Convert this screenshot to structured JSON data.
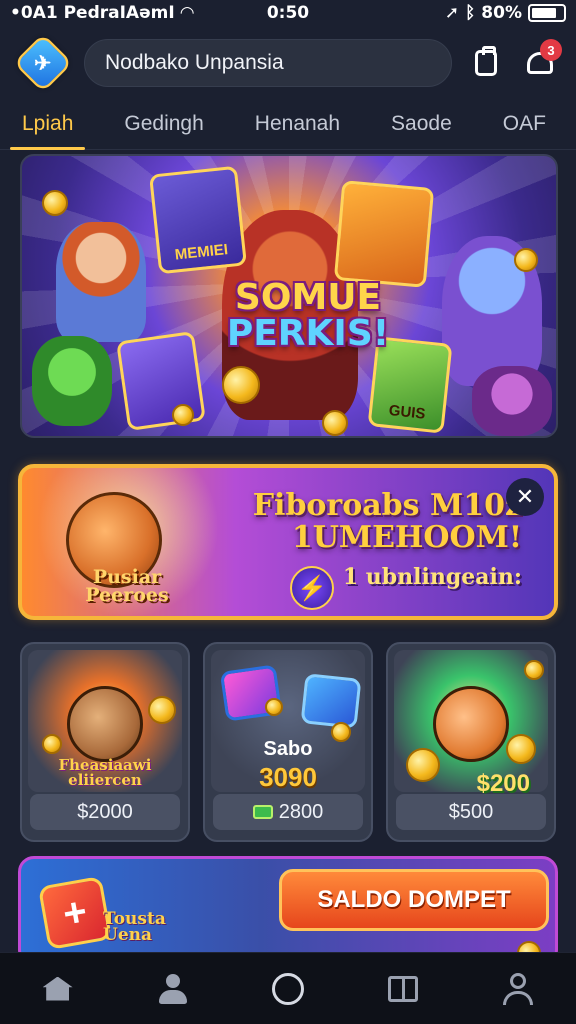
{
  "status_bar": {
    "carrier": "•0A1 PedraІAəmI",
    "time": "0:50",
    "battery": "80%",
    "icons": [
      "wifi-icon",
      "location-icon",
      "bluetooth-icon",
      "battery-icon"
    ]
  },
  "header": {
    "search_value": "Nodbako Unpansia",
    "notification_count": "3",
    "icons": [
      "app-logo-icon",
      "wallet-icon",
      "notification-icon"
    ]
  },
  "tabs": [
    {
      "label": "Lpiah",
      "active": true
    },
    {
      "label": "Gedingh",
      "active": false
    },
    {
      "label": "Henanah",
      "active": false
    },
    {
      "label": "Saode",
      "active": false
    },
    {
      "label": "OAF",
      "active": false
    }
  ],
  "hero": {
    "title_line1": "SOMUE",
    "title_line2": "PERKIS!",
    "card_left_label": "MEMIEI",
    "card_right_label": "GUIS"
  },
  "promo": {
    "title_line1": "Fiboroabs M10z",
    "title_line2": "1UMEHOOM!",
    "subtitle": "1 ubnlingeain:",
    "pet_label_line1": "Pusiar",
    "pet_label_line2": "Peeroes",
    "close_symbol": "✕",
    "bolt_symbol": "⚡"
  },
  "offers": [
    {
      "caption_line1": "Fheasiaawi",
      "caption_line2": "eliiercen",
      "price": "$2000"
    },
    {
      "title": "Sabo",
      "value": "3090",
      "price": "2800"
    },
    {
      "art_amount": "$200",
      "price": "$500"
    }
  ],
  "wallet_banner": {
    "button_label": "SALDO DOMPET",
    "tile_symbol": "+",
    "label_line1": "Tousta",
    "label_line2": "Uena"
  },
  "bottom_nav": [
    {
      "name": "home",
      "icon": "home-icon"
    },
    {
      "name": "profile",
      "icon": "person-icon"
    },
    {
      "name": "center",
      "icon": "circle-icon"
    },
    {
      "name": "book",
      "icon": "book-icon"
    },
    {
      "name": "account",
      "icon": "user-outline-icon"
    }
  ],
  "colors": {
    "accent": "#ffc94a",
    "background": "#1b2030",
    "button_orange": "#e6461c"
  }
}
